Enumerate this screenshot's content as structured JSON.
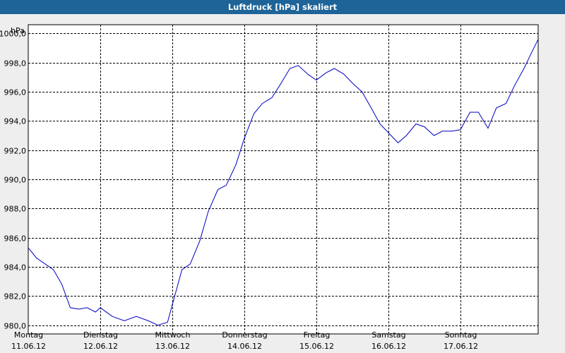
{
  "window": {
    "title": "Luftdruck [hPa] skaliert"
  },
  "chart_data": {
    "type": "line",
    "title": "Luftdruck [hPa] skaliert",
    "ylabel": "hPa",
    "ylim": [
      979.4,
      1000.6
    ],
    "yticks": [
      980,
      982,
      984,
      986,
      988,
      990,
      992,
      994,
      996,
      998,
      1000
    ],
    "ytick_labels": [
      "980,0",
      "982,0",
      "984,0",
      "986,0",
      "988,0",
      "990,0",
      "992,0",
      "994,0",
      "996,0",
      "998,0",
      "1000,0"
    ],
    "xlim_days": [
      0,
      7.08
    ],
    "grid": true,
    "line_color": "#0000c0",
    "xticks": [
      {
        "day": "Montag",
        "date": "11.06.12"
      },
      {
        "day": "Dienstag",
        "date": "12.06.12"
      },
      {
        "day": "Mittwoch",
        "date": "13.06.12"
      },
      {
        "day": "Donnerstag",
        "date": "14.06.12"
      },
      {
        "day": "Freitag",
        "date": "15.06.12"
      },
      {
        "day": "Samstag",
        "date": "16.06.12"
      },
      {
        "day": "Sonntag",
        "date": "17.06.12"
      }
    ],
    "series": [
      {
        "x": [
          "11.06.12 00:00",
          "11.06.12 02:48",
          "11.06.12 05:36",
          "11.06.12 08:24",
          "11.06.12 11:12",
          "11.06.12 14:00",
          "11.06.12 16:48",
          "11.06.12 19:36",
          "11.06.12 22:24",
          "12.06.12 00:00",
          "12.06.12 04:00",
          "12.06.12 08:00",
          "12.06.12 12:00",
          "12.06.12 16:00",
          "12.06.12 19:12",
          "12.06.12 22:24",
          "13.06.12 00:48",
          "13.06.12 03:12",
          "13.06.12 06:00",
          "13.06.12 09:12",
          "13.06.12 12:00",
          "13.06.12 15:12",
          "13.06.12 18:00",
          "13.06.12 21:12",
          "14.06.12 00:00",
          "14.06.12 03:12",
          "14.06.12 06:00",
          "14.06.12 09:12",
          "14.06.12 12:00",
          "14.06.12 15:12",
          "14.06.12 18:00",
          "14.06.12 21:12",
          "15.06.12 00:00",
          "15.06.12 03:12",
          "15.06.12 06:00",
          "15.06.12 09:12",
          "15.06.12 12:00",
          "15.06.12 15:12",
          "15.06.12 18:00",
          "15.06.12 21:12",
          "16.06.12 00:00",
          "16.06.12 03:12",
          "16.06.12 06:00",
          "16.06.12 09:12",
          "16.06.12 12:00",
          "16.06.12 15:12",
          "16.06.12 18:00",
          "16.06.12 21:12",
          "17.06.12 00:00",
          "17.06.12 03:12",
          "17.06.12 06:00",
          "17.06.12 09:12",
          "17.06.12 12:00",
          "17.06.12 15:12",
          "17.06.12 18:00",
          "17.06.12 21:12",
          "18.06.12 00:00",
          "18.06.12 01:55"
        ],
        "y": [
          985.3,
          984.6,
          984.2,
          983.8,
          982.8,
          981.2,
          981.1,
          981.2,
          980.9,
          981.2,
          980.6,
          980.3,
          980.6,
          980.3,
          980.0,
          980.2,
          982.0,
          983.8,
          984.2,
          985.8,
          987.8,
          989.3,
          989.6,
          991.0,
          992.8,
          994.5,
          995.2,
          995.6,
          996.5,
          997.6,
          997.8,
          997.2,
          996.8,
          997.3,
          997.6,
          997.2,
          996.6,
          996.0,
          995.0,
          993.8,
          993.2,
          992.5,
          993.0,
          993.8,
          993.6,
          993.0,
          993.3,
          993.3,
          993.4,
          994.6,
          994.6,
          993.5,
          994.9,
          995.2,
          996.4,
          997.6,
          998.8,
          999.6
        ]
      }
    ]
  }
}
